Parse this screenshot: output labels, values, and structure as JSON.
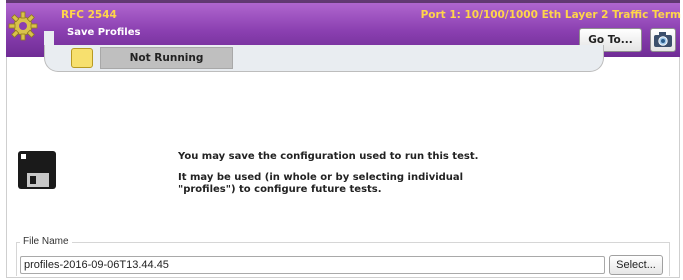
{
  "header": {
    "test_name": "RFC 2544",
    "page_name": "Save Profiles",
    "port_info": "Port 1: 10/100/1000 Eth Layer 2 Traffic Term",
    "goto_label": "Go To...",
    "gear_icon": "gear-icon",
    "camera_icon": "camera-icon"
  },
  "status": {
    "flag_icon": "status-flag-icon",
    "text": "Not Running"
  },
  "main": {
    "icon": "floppy-disk-icon",
    "message_line1": "You may save the configuration used to run this test.",
    "message_line2": "It may be used (in whole or by selecting individual \"profiles\") to configure future tests."
  },
  "file": {
    "label": "File Name",
    "value": "profiles-2016-09-06T13.44.45",
    "select_label": "Select..."
  },
  "colors": {
    "header_purple": "#8a3fb0",
    "title_yellow": "#ffd54a",
    "status_flag": "#f7e06e"
  }
}
